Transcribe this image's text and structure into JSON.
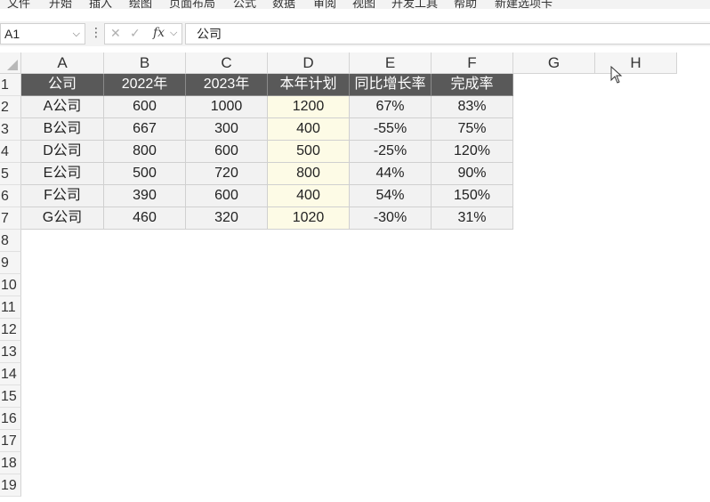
{
  "ribbon": {
    "tabs": [
      "文件",
      "开始",
      "插入",
      "绘图",
      "页面布局",
      "公式",
      "数据",
      "审阅",
      "视图",
      "开发工具",
      "帮助",
      "新建选项卡"
    ]
  },
  "formula_bar": {
    "name_box": "A1",
    "content": "公司",
    "fx_label": "fx",
    "cancel_glyph": "✕",
    "confirm_glyph": "✓"
  },
  "columns": [
    "A",
    "B",
    "C",
    "D",
    "E",
    "F",
    "G",
    "H"
  ],
  "rows": [
    "1",
    "2",
    "3",
    "4",
    "5",
    "6",
    "7",
    "8",
    "9",
    "10",
    "11",
    "12",
    "13",
    "14",
    "15",
    "16",
    "17",
    "18",
    "19"
  ],
  "table": {
    "headers": [
      "公司",
      "2022年",
      "2023年",
      "本年计划",
      "同比增长率",
      "完成率"
    ],
    "rows": [
      [
        "A公司",
        "600",
        "1000",
        "1200",
        "67%",
        "83%"
      ],
      [
        "B公司",
        "667",
        "300",
        "400",
        "-55%",
        "75%"
      ],
      [
        "D公司",
        "800",
        "600",
        "500",
        "-25%",
        "120%"
      ],
      [
        "E公司",
        "500",
        "720",
        "800",
        "44%",
        "90%"
      ],
      [
        "F公司",
        "390",
        "600",
        "400",
        "54%",
        "150%"
      ],
      [
        "G公司",
        "460",
        "320",
        "1020",
        "-30%",
        "31%"
      ]
    ]
  },
  "colors": {
    "header_fill": "#595959",
    "plan_fill": "#fdfbe6",
    "data_fill": "#f2f2f2"
  }
}
